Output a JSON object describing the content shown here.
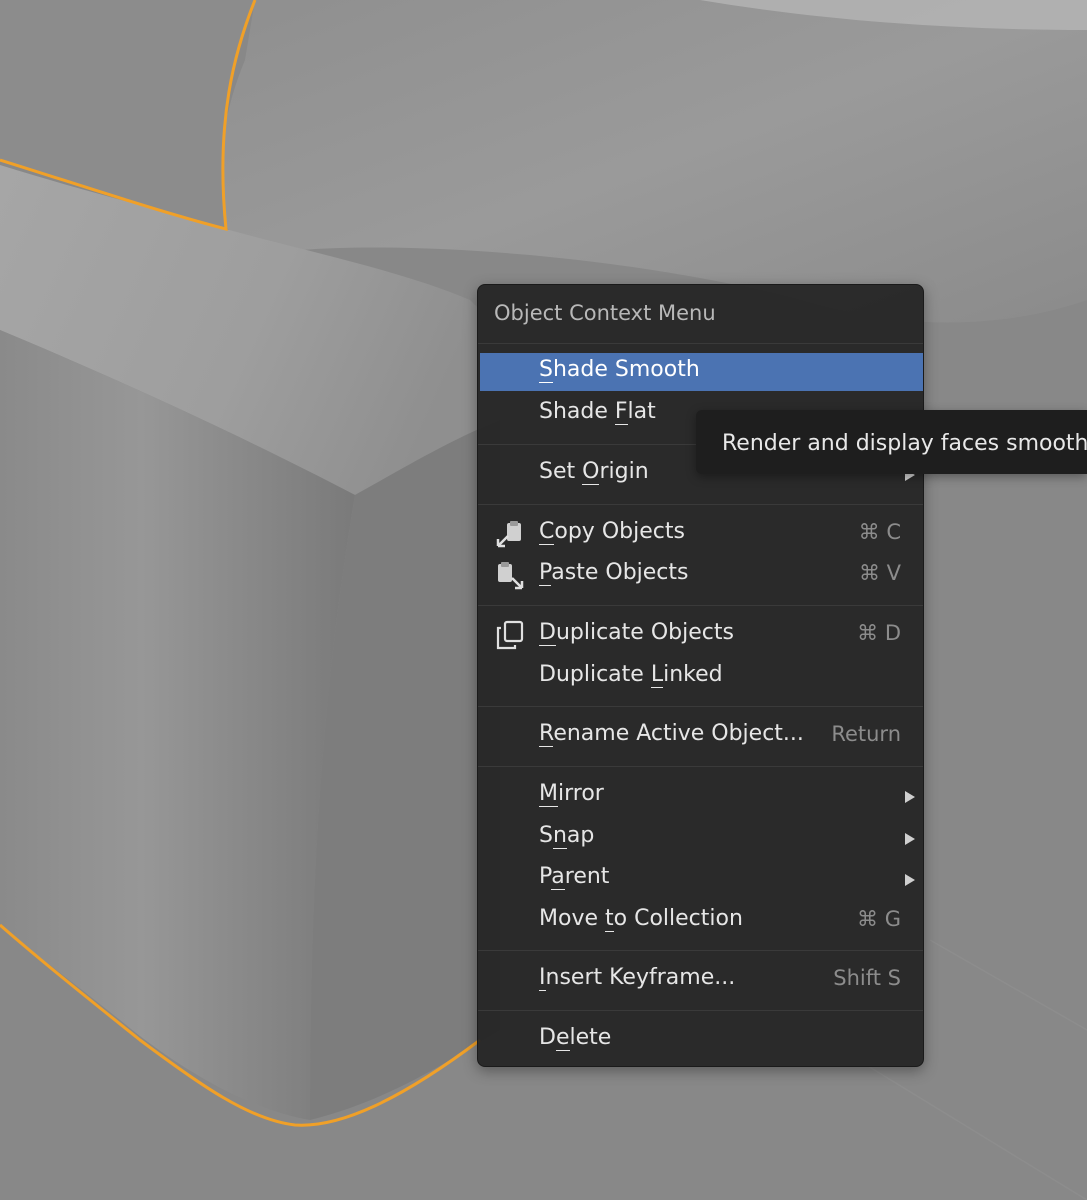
{
  "menu": {
    "title": "Object Context Menu",
    "items": [
      {
        "label": "Shade Smooth",
        "mn": 0,
        "highlighted": true
      },
      {
        "label": "Shade Flat",
        "mn": 6
      },
      {
        "label": "Set Origin",
        "mn": 4,
        "submenu": true
      },
      {
        "label": "Copy Objects",
        "mn": 0,
        "shortcut": "⌘ C",
        "icon": "copy-icon"
      },
      {
        "label": "Paste Objects",
        "mn": 0,
        "shortcut": "⌘ V",
        "icon": "paste-icon"
      },
      {
        "label": "Duplicate Objects",
        "mn": 0,
        "shortcut": "⌘ D",
        "icon": "duplicate-icon"
      },
      {
        "label": "Duplicate Linked",
        "mn": 10
      },
      {
        "label": "Rename Active Object...",
        "mn": 0,
        "shortcut": "Return"
      },
      {
        "label": "Mirror",
        "mn": 0,
        "submenu": true
      },
      {
        "label": "Snap",
        "mn": 1,
        "submenu": true
      },
      {
        "label": "Parent",
        "mn": 1,
        "submenu": true
      },
      {
        "label": "Move to Collection",
        "mn": 5,
        "shortcut": "⌘ G"
      },
      {
        "label": "Insert Keyframe...",
        "mn": 0,
        "shortcut": "Shift S"
      },
      {
        "label": "Delete",
        "mn": 1
      }
    ]
  },
  "tooltip": {
    "text": "Render and display faces smooth"
  },
  "colors": {
    "highlight": "#4b73b2",
    "selection_outline": "#f0a028",
    "viewport_bg": "#888888"
  }
}
